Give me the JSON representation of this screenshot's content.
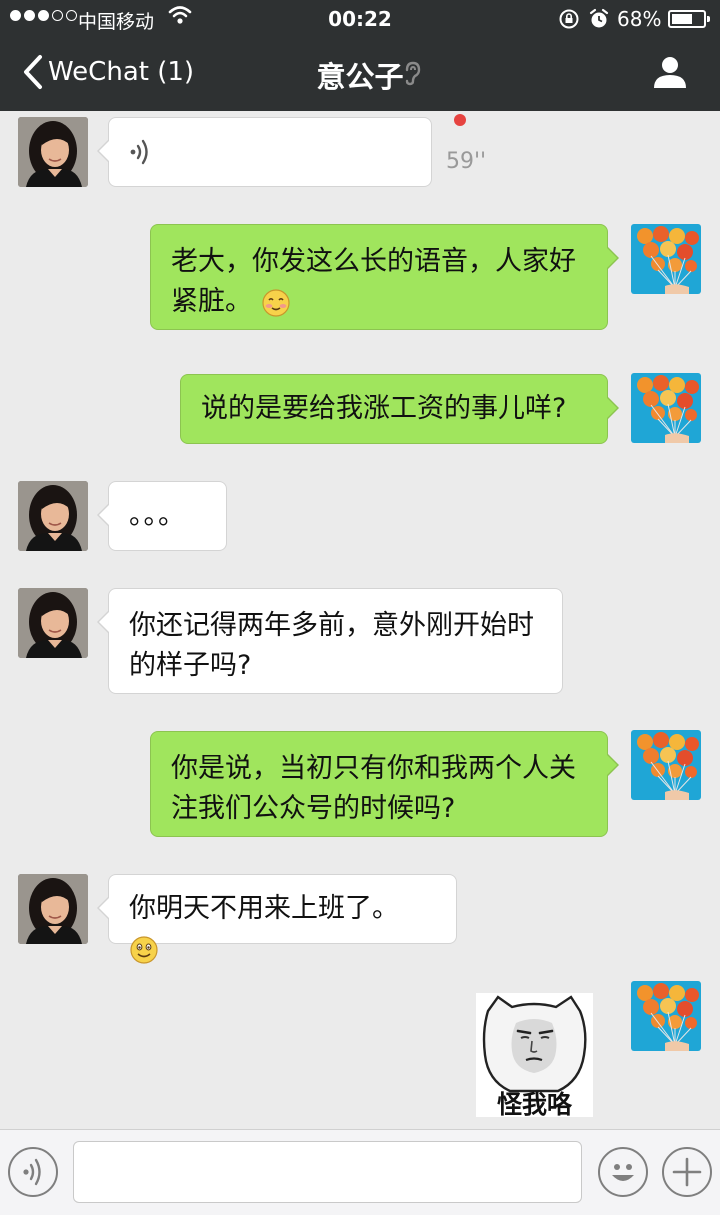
{
  "status_bar": {
    "carrier": "中国移动",
    "time": "00:22",
    "battery_percent": "68%",
    "battery_level": 0.68
  },
  "nav": {
    "back_label": "WeChat (1)",
    "title": "意公子",
    "icons": {
      "back": "chevron-left-icon",
      "earpiece": "ear-icon",
      "profile": "person-icon"
    }
  },
  "messages": [
    {
      "side": "in",
      "type": "voice",
      "duration": "59''",
      "unread": true
    },
    {
      "side": "out",
      "type": "text",
      "line1": "老大，你发这么长的语音，人家好",
      "line2": "紧脏。",
      "emoji": "shy-smile-emoji"
    },
    {
      "side": "out",
      "type": "text",
      "line1": "说的是要给我涨工资的事儿咩?"
    },
    {
      "side": "in",
      "type": "text",
      "line1": "。。。"
    },
    {
      "side": "in",
      "type": "text",
      "line1": "你还记得两年多前，意外刚开始时",
      "line2": "的样子吗?"
    },
    {
      "side": "out",
      "type": "text",
      "line1": "你是说，当初只有你和我两个人关",
      "line2": "注我们公众号的时候吗?"
    },
    {
      "side": "in",
      "type": "text",
      "line1": "你明天不用来上班了。",
      "emoji": "smile-emoji"
    },
    {
      "side": "out",
      "type": "sticker",
      "caption": "怪我咯"
    }
  ],
  "input_bar": {
    "value": "",
    "placeholder": "",
    "icons": {
      "voice": "voice-icon",
      "emoji": "emoji-icon",
      "more": "plus-icon"
    }
  },
  "colors": {
    "nav_bg": "#2e3132",
    "chat_bg": "#ebebeb",
    "outgoing_bubble": "#a0e55d",
    "incoming_bubble": "#ffffff",
    "unread_dot": "#e64340"
  }
}
